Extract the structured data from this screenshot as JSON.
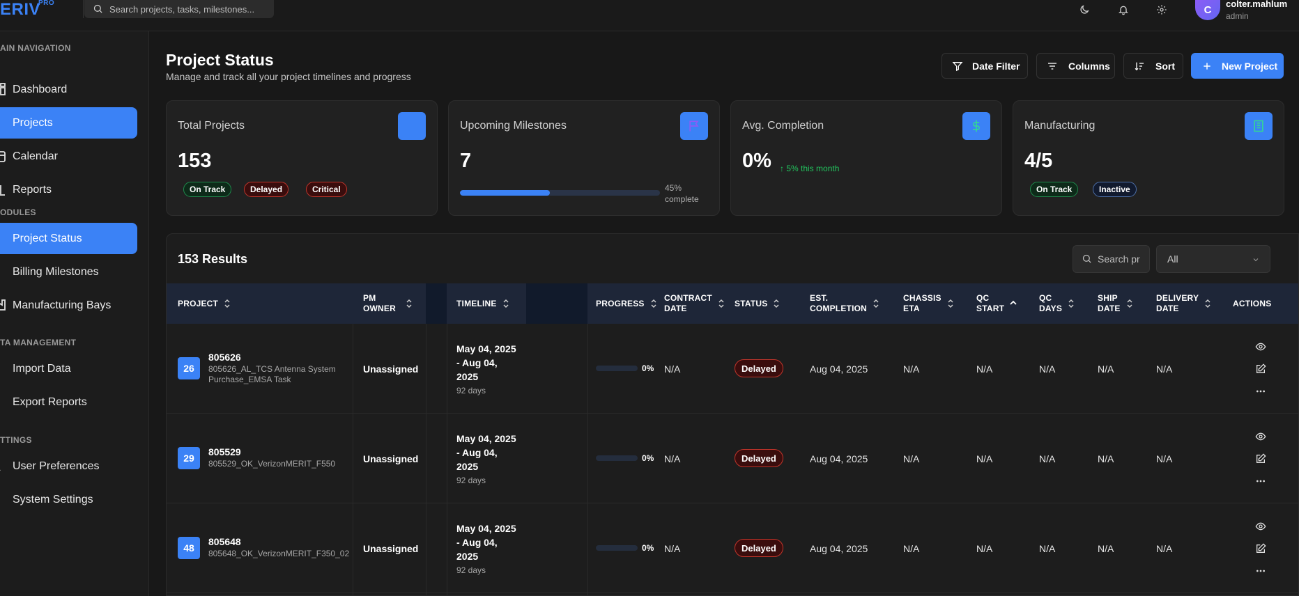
{
  "app": {
    "logo_text": "ERIV",
    "logo_badge": "PRO",
    "search_placeholder": "Search projects, tasks, milestones...",
    "user": {
      "initial": "C",
      "name": "colter.mahlum",
      "role": "admin"
    }
  },
  "sidebar": {
    "sections": [
      {
        "title": "AIN NAVIGATION"
      },
      {
        "title": "ODULES"
      },
      {
        "title": "TA MANAGEMENT"
      },
      {
        "title": "TTINGS"
      }
    ],
    "items": [
      {
        "label": "Dashboard",
        "icon": "dashboard-icon"
      },
      {
        "label": "Projects",
        "icon": "folder-icon",
        "active": true
      },
      {
        "label": "Calendar",
        "icon": "calendar-icon"
      },
      {
        "label": "Reports",
        "icon": "bar-chart-icon"
      },
      {
        "label": "Project Status",
        "icon": "status-icon",
        "active": true
      },
      {
        "label": "Billing Milestones",
        "icon": "billing-icon"
      },
      {
        "label": "Manufacturing Bays",
        "icon": "factory-icon"
      },
      {
        "label": "Import Data",
        "icon": "import-icon"
      },
      {
        "label": "Export Reports",
        "icon": "export-icon"
      },
      {
        "label": "User Preferences",
        "icon": "user-icon"
      },
      {
        "label": "System Settings",
        "icon": "gear-icon"
      }
    ]
  },
  "header": {
    "title": "Project Status",
    "subtitle": "Manage and track all your project timelines and progress",
    "buttons": {
      "date_filter": "Date Filter",
      "columns": "Columns",
      "sort": "Sort",
      "new_project": "New Project"
    }
  },
  "cards": {
    "total": {
      "title": "Total Projects",
      "value": "153",
      "badges": [
        "On Track",
        "Delayed",
        "Critical"
      ]
    },
    "milestones": {
      "title": "Upcoming Milestones",
      "value": "7",
      "progress": 0.45,
      "progress_note_1": "45%",
      "progress_note_2": "complete"
    },
    "completion": {
      "title": "Avg. Completion",
      "value": "0%",
      "trend": "↑ 5% this month"
    },
    "manufacturing": {
      "title": "Manufacturing",
      "value": "4/5",
      "badges": [
        "On Track",
        "Inactive"
      ]
    }
  },
  "table": {
    "results": "153 Results",
    "search_placeholder": "Search pr",
    "filter_value": "All",
    "headers": {
      "project": "PROJECT",
      "pm_owner_1": "PM",
      "pm_owner_2": "OWNER",
      "timeline": "TIMELINE",
      "progress": "PROGRESS",
      "contract_1": "CONTRACT",
      "contract_2": "DATE",
      "status": "STATUS",
      "est_1": "EST.",
      "est_2": "COMPLETION",
      "chassis_1": "CHASSIS",
      "chassis_2": "ETA",
      "qc_start_1": "QC",
      "qc_start_2": "START",
      "qc_days_1": "QC",
      "qc_days_2": "DAYS",
      "ship_1": "SHIP",
      "ship_2": "DATE",
      "delivery_1": "DELIVERY",
      "delivery_2": "DATE",
      "actions": "ACTIONS"
    },
    "rows": [
      {
        "badge": "26",
        "id": "805626",
        "name": "805626_AL_TCS Antenna System Purchase_EMSA Task",
        "owner": "Unassigned",
        "timeline": "May 04, 2025 - Aug 04, 2025",
        "days": "92 days",
        "progress": 0,
        "progress_label": "0%",
        "contract": "N/A",
        "status": "Delayed",
        "est": "Aug 04, 2025",
        "chassis": "N/A",
        "qc_start": "N/A",
        "qc_days": "N/A",
        "ship": "N/A",
        "delivery": "N/A"
      },
      {
        "badge": "29",
        "id": "805529",
        "name": "805529_OK_VerizonMERIT_F550",
        "owner": "Unassigned",
        "timeline": "May 04, 2025 - Aug 04, 2025",
        "days": "92 days",
        "progress": 0,
        "progress_label": "0%",
        "contract": "N/A",
        "status": "Delayed",
        "est": "Aug 04, 2025",
        "chassis": "N/A",
        "qc_start": "N/A",
        "qc_days": "N/A",
        "ship": "N/A",
        "delivery": "N/A"
      },
      {
        "badge": "48",
        "id": "805648",
        "name": "805648_OK_VerizonMERIT_F350_02",
        "owner": "Unassigned",
        "timeline": "May 04, 2025 - Aug 04, 2025",
        "days": "92 days",
        "progress": 0,
        "progress_label": "0%",
        "contract": "N/A",
        "status": "Delayed",
        "est": "Aug 04, 2025",
        "chassis": "N/A",
        "qc_start": "N/A",
        "qc_days": "N/A",
        "ship": "N/A",
        "delivery": "N/A"
      }
    ]
  },
  "colors": {
    "accent": "#3b82f6",
    "background": "#181818",
    "success": "#22c55e",
    "danger": "#c0352b"
  }
}
